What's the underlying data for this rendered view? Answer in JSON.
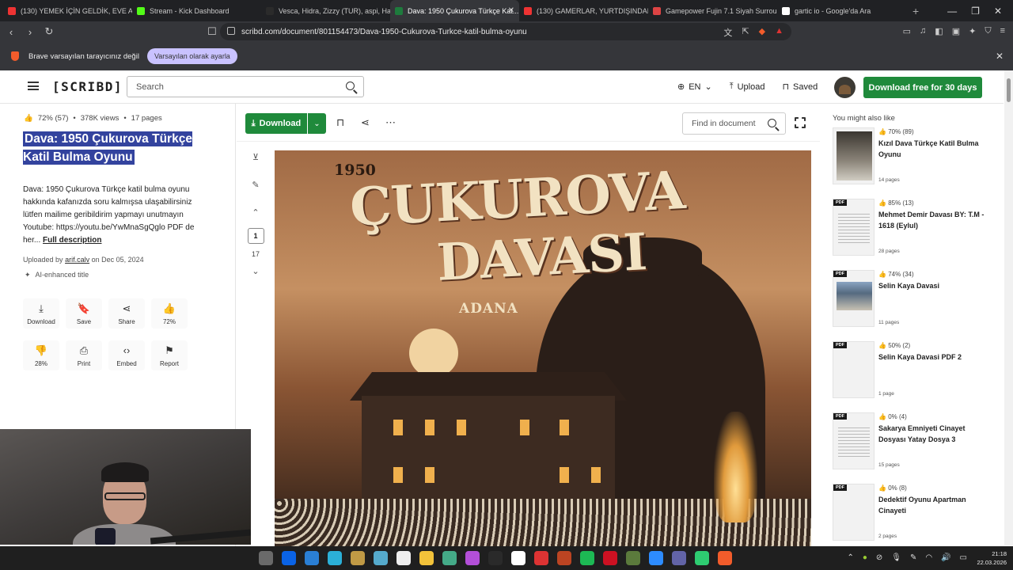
{
  "browser": {
    "tabs": [
      {
        "label": "(130) YEMEK İÇİN GELDİK, EVE ALMA...",
        "color": "#e33",
        "active": false
      },
      {
        "label": "Stream - Kick Dashboard",
        "color": "#53fc18",
        "active": false
      },
      {
        "label": "Vesca, Hidra, Zizzy (TUR), aspi, Harim...",
        "color": "#2b2b2b",
        "active": false
      },
      {
        "label": "Dava: 1950 Çukurova Türkçe Kat...",
        "color": "#1e7b3d",
        "active": true
      },
      {
        "label": "(130) GAMERLAR, YURTDIŞINDAN R...",
        "color": "#e33",
        "active": false
      },
      {
        "label": "Gamepower Fujin 7.1 Siyah Surround...",
        "color": "#d44",
        "active": false
      },
      {
        "label": "gartic io - Google'da Ara",
        "color": "#fff",
        "active": false
      }
    ],
    "url": "scribd.com/document/801154473/Dava-1950-Cukurova-Turkce-katil-bulma-oyunu",
    "infobar_text": "Brave varsayılan tarayıcınız değil",
    "infobar_button": "Varsayılan olarak ayarla"
  },
  "header": {
    "logo": "[SCRIBD]",
    "search_placeholder": "Search",
    "lang": "EN",
    "upload": "Upload",
    "saved": "Saved",
    "cta": "Download free for 30 days"
  },
  "document": {
    "rating": "72% (57)",
    "views": "378K views",
    "pages": "17 pages",
    "title": "Dava: 1950 Çukurova Türkçe Katil Bulma Oyunu",
    "description": "Dava: 1950 Çukurova Türkçe katil bulma oyunu hakkında kafanızda soru kalmışsa ulaşabilirsiniz lütfen mailime geribildirim yapmayı unutmayın Youtube: https://youtu.be/YwMnaSgQglo PDF de her...",
    "full_description": "Full description",
    "uploaded_prefix": "Uploaded by",
    "uploader": "arif.calv",
    "uploaded_date": "on Dec 05, 2024",
    "ai_title": "AI-enhanced title",
    "actions": [
      {
        "icon": "download-icon",
        "glyph": "⤓",
        "label": "Download"
      },
      {
        "icon": "bookmark-icon",
        "glyph": "🔖",
        "label": "Save"
      },
      {
        "icon": "share-icon",
        "glyph": "⋖",
        "label": "Share"
      },
      {
        "icon": "thumbs-up-icon",
        "glyph": "👍",
        "label": "72%"
      },
      {
        "icon": "thumbs-down-icon",
        "glyph": "👎",
        "label": "28%"
      },
      {
        "icon": "print-icon",
        "glyph": "⎙",
        "label": "Print"
      },
      {
        "icon": "embed-icon",
        "glyph": "‹›",
        "label": "Embed"
      },
      {
        "icon": "flag-icon",
        "glyph": "⚑",
        "label": "Report"
      }
    ]
  },
  "toolbar": {
    "download": "Download",
    "find_placeholder": "Find in document",
    "current_page": "1",
    "total_pages": "17"
  },
  "cover": {
    "year": "1950",
    "line1": "ÇUKUROVA",
    "line2": "DAVASI",
    "city": "ADANA"
  },
  "sidebar": {
    "heading": "You might also like",
    "items": [
      {
        "rating": "70% (89)",
        "title": "Kızıl Dava Türkçe Katil Bulma Oyunu",
        "pages": "14 pages",
        "pdf": "",
        "thumb": "dark"
      },
      {
        "rating": "85% (13)",
        "title": "Mehmet Demir Davası BY: T.M - 1618 (Eylul)",
        "pages": "28 pages",
        "pdf": "PDF",
        "thumb": "lines"
      },
      {
        "rating": "74% (34)",
        "title": "Selin Kaya Davasi",
        "pages": "11 pages",
        "pdf": "PDF",
        "thumb": "photo"
      },
      {
        "rating": "50% (2)",
        "title": "Selin Kaya Davasi PDF 2",
        "pages": "1 page",
        "pdf": "PDF",
        "thumb": "blank"
      },
      {
        "rating": "0% (4)",
        "title": "Sakarya Emniyeti Cinayet Dosyası Yatay Dosya 3",
        "pages": "15 pages",
        "pdf": "PDF",
        "thumb": "lines"
      },
      {
        "rating": "0% (8)",
        "title": "Dedektif Oyunu Apartman Cinayeti",
        "pages": "2 pages",
        "pdf": "PDF",
        "thumb": "blank"
      }
    ]
  },
  "taskbar": {
    "time": "21:18",
    "date": "22.03.2026"
  }
}
